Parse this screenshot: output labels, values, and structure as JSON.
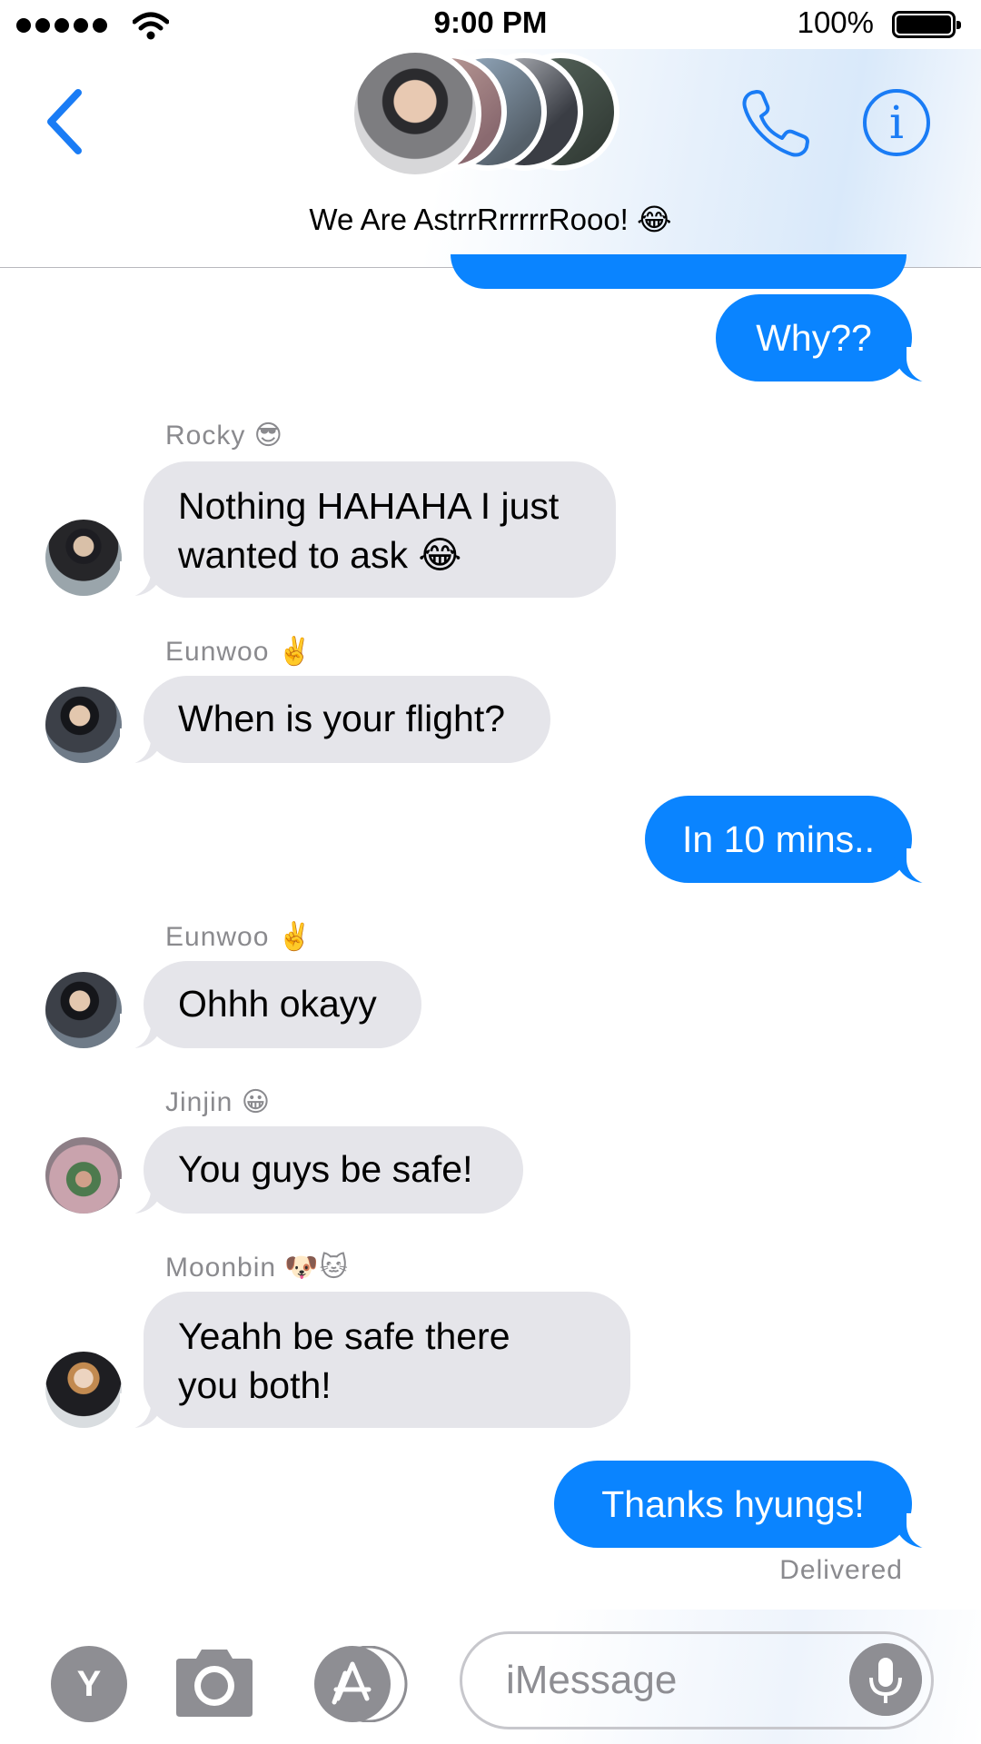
{
  "status_bar": {
    "time": "9:00 PM",
    "battery": "100%"
  },
  "header": {
    "group_name": "We Are AstrrRrrrrrRooo! 😂"
  },
  "messages": {
    "m1": {
      "text": "Why??"
    },
    "m2": {
      "sender": "Rocky 😎",
      "text_line1": "Nothing HAHAHA I just",
      "text_line2": "wanted to ask 😂"
    },
    "m3": {
      "sender": "Eunwoo ✌️",
      "text": "When is your flight?"
    },
    "m4": {
      "text": "In 10 mins.."
    },
    "m5": {
      "sender": "Eunwoo ✌️",
      "text": "Ohhh okayy"
    },
    "m6": {
      "sender": "Jinjin 😀",
      "text": "You guys be safe!"
    },
    "m7": {
      "sender": "Moonbin 🐶🐱",
      "text_line1": "Yeahh be safe there",
      "text_line2": "you both!"
    },
    "m8": {
      "text": "Thanks hyungs!"
    },
    "delivered": "Delivered"
  },
  "input_bar": {
    "app_letter": "Y",
    "placeholder": "iMessage"
  },
  "colors": {
    "accent": "#0a84ff",
    "incoming": "#e5e5ea",
    "secondary_text": "#8a8a8e",
    "tool_grey": "#8e8e93"
  }
}
